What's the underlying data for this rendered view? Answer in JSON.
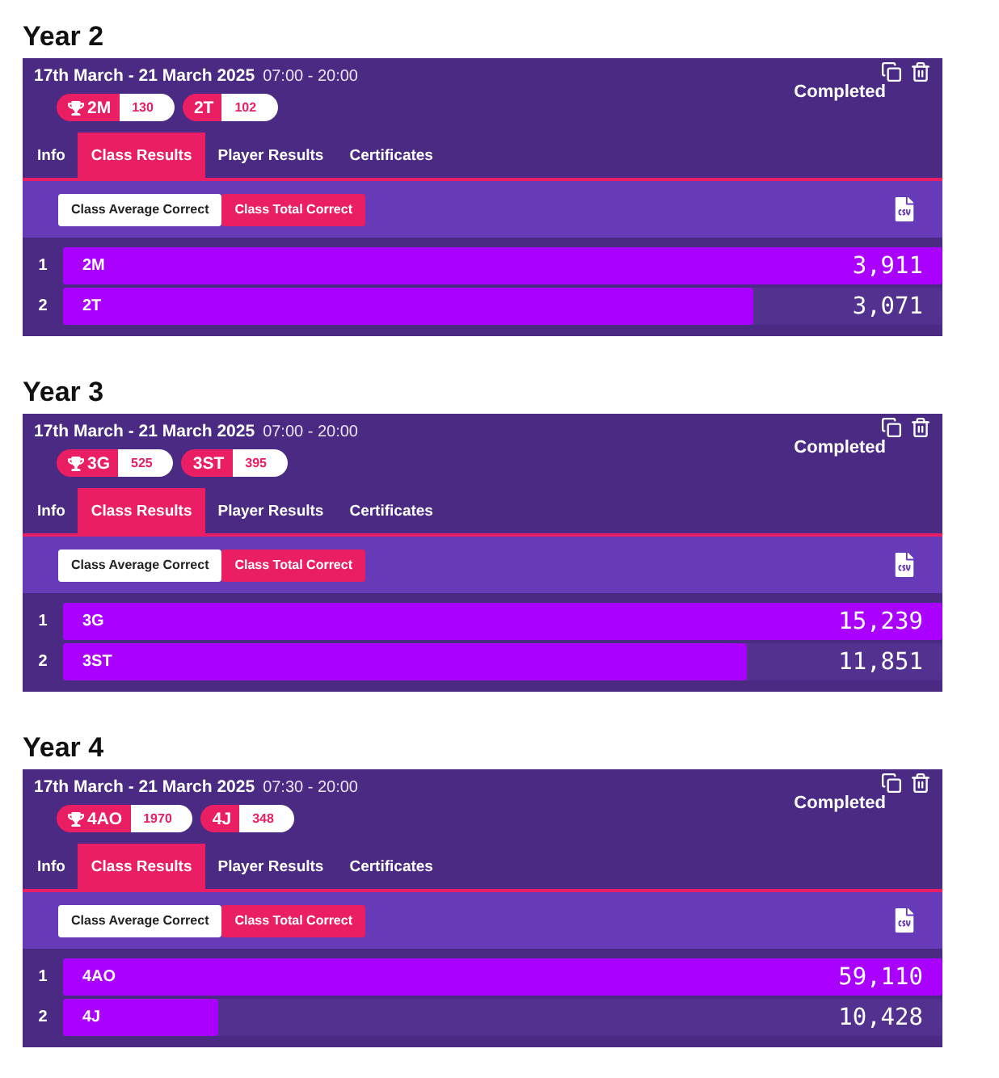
{
  "sections": [
    {
      "heading": "Year 2",
      "date": "17th March - 21 March 2025",
      "time": "07:00 - 20:00",
      "status": "Completed",
      "badges": [
        {
          "name": "2M",
          "score": "130",
          "trophy": true
        },
        {
          "name": "2T",
          "score": "102",
          "trophy": false
        }
      ],
      "tabs": [
        {
          "label": "Info",
          "selected": false
        },
        {
          "label": "Class Results",
          "selected": true
        },
        {
          "label": "Player Results",
          "selected": false
        },
        {
          "label": "Certificates",
          "selected": false
        }
      ],
      "metric_toggle": [
        {
          "label": "Class Average Correct",
          "selected": false
        },
        {
          "label": "Class Total Correct",
          "selected": true
        }
      ],
      "rows": [
        {
          "rank": "1",
          "name": "2M",
          "value": "3,911",
          "level": 1
        },
        {
          "rank": "2",
          "name": "2T",
          "value": "3,071",
          "level": 0.785
        }
      ]
    },
    {
      "heading": "Year 3",
      "date": "17th March - 21 March 2025",
      "time": "07:00 - 20:00",
      "status": "Completed",
      "badges": [
        {
          "name": "3G",
          "score": "525",
          "trophy": true
        },
        {
          "name": "3ST",
          "score": "395",
          "trophy": false
        }
      ],
      "tabs": [
        {
          "label": "Info",
          "selected": false
        },
        {
          "label": "Class Results",
          "selected": true
        },
        {
          "label": "Player Results",
          "selected": false
        },
        {
          "label": "Certificates",
          "selected": false
        }
      ],
      "metric_toggle": [
        {
          "label": "Class Average Correct",
          "selected": false
        },
        {
          "label": "Class Total Correct",
          "selected": true
        }
      ],
      "rows": [
        {
          "rank": "1",
          "name": "3G",
          "value": "15,239",
          "level": 1
        },
        {
          "rank": "2",
          "name": "3ST",
          "value": "11,851",
          "level": 0.778
        }
      ]
    },
    {
      "heading": "Year 4",
      "date": "17th March - 21 March 2025",
      "time": "07:30 - 20:00",
      "status": "Completed",
      "badges": [
        {
          "name": "4AO",
          "score": "1970",
          "trophy": true
        },
        {
          "name": "4J",
          "score": "348",
          "trophy": false
        }
      ],
      "tabs": [
        {
          "label": "Info",
          "selected": false
        },
        {
          "label": "Class Results",
          "selected": true
        },
        {
          "label": "Player Results",
          "selected": false
        },
        {
          "label": "Certificates",
          "selected": false
        }
      ],
      "metric_toggle": [
        {
          "label": "Class Average Correct",
          "selected": false
        },
        {
          "label": "Class Total Correct",
          "selected": true
        }
      ],
      "rows": [
        {
          "rank": "1",
          "name": "4AO",
          "value": "59,110",
          "level": 1
        },
        {
          "rank": "2",
          "name": "4J",
          "value": "10,428",
          "level": 0.176
        }
      ]
    }
  ]
}
